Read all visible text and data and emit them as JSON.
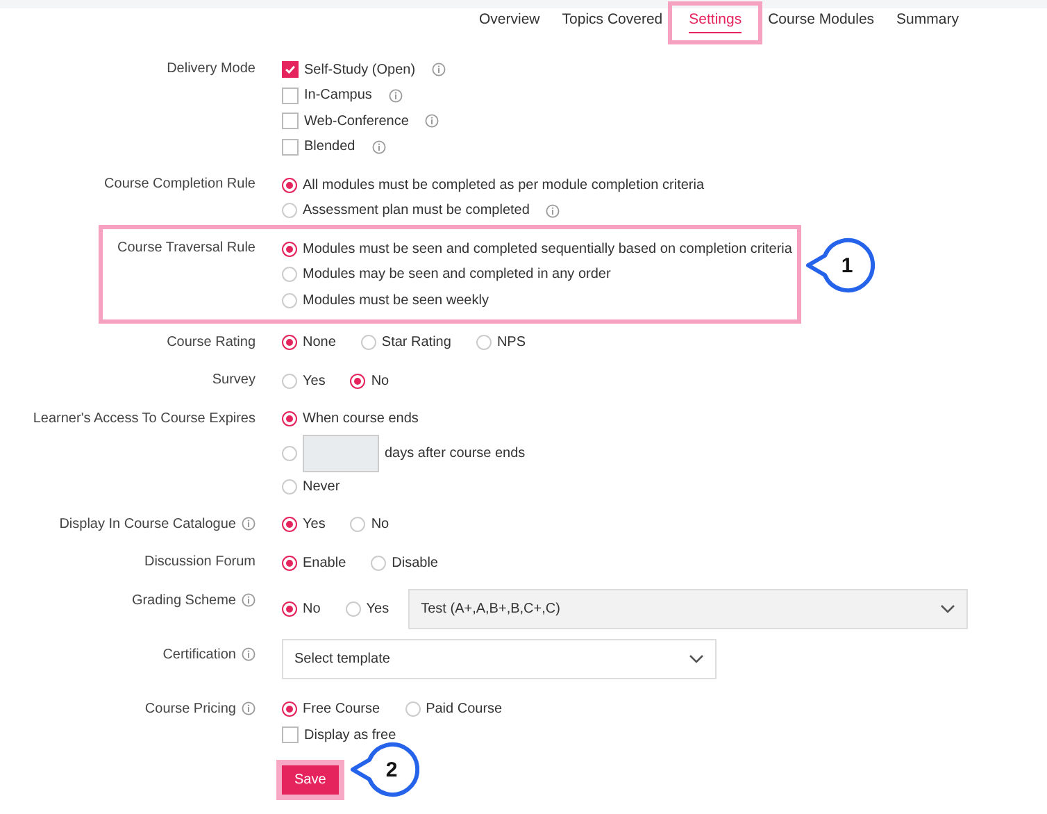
{
  "tabs": [
    {
      "label": "Overview",
      "selected": false,
      "highlighted": false
    },
    {
      "label": "Topics Covered",
      "selected": false,
      "highlighted": false
    },
    {
      "label": "Settings",
      "selected": true,
      "highlighted": true
    },
    {
      "label": "Course Modules",
      "selected": false,
      "highlighted": false
    },
    {
      "label": "Summary",
      "selected": false,
      "highlighted": false
    }
  ],
  "fields": [
    {
      "label": "Delivery Mode",
      "info": false,
      "highlighted": false,
      "lines": [
        [
          {
            "kind": "checkbox",
            "label": "Self-Study (Open)",
            "checked": true,
            "info": true
          }
        ],
        [
          {
            "kind": "checkbox",
            "label": "In-Campus",
            "checked": false,
            "info": true
          }
        ],
        [
          {
            "kind": "checkbox",
            "label": "Web-Conference",
            "checked": false,
            "info": true
          }
        ],
        [
          {
            "kind": "checkbox",
            "label": "Blended",
            "checked": false,
            "info": true
          }
        ]
      ]
    },
    {
      "label": "Course Completion Rule",
      "info": false,
      "highlighted": false,
      "lines": [
        [
          {
            "kind": "radio",
            "label": "All modules must be completed as per module completion criteria",
            "selected": true,
            "info": false
          }
        ],
        [
          {
            "kind": "radio",
            "label": "Assessment plan must be completed",
            "selected": false,
            "info": true
          }
        ]
      ]
    },
    {
      "label": "Course Traversal Rule",
      "info": false,
      "highlighted": true,
      "callout": "1",
      "lines": [
        [
          {
            "kind": "radio",
            "label": "Modules must be seen and completed sequentially based on completion criteria",
            "selected": true,
            "info": false
          }
        ],
        [
          {
            "kind": "radio",
            "label": "Modules may be seen and completed in any order",
            "selected": false,
            "info": false
          }
        ],
        [
          {
            "kind": "radio",
            "label": "Modules must be seen weekly",
            "selected": false,
            "info": false
          }
        ]
      ]
    },
    {
      "label": "Course Rating",
      "info": false,
      "highlighted": false,
      "lines": [
        [
          {
            "kind": "radio",
            "label": "None",
            "selected": true,
            "info": false
          },
          {
            "kind": "radio",
            "label": "Star Rating",
            "selected": false,
            "info": false
          },
          {
            "kind": "radio",
            "label": "NPS",
            "selected": false,
            "info": false
          }
        ]
      ]
    },
    {
      "label": "Survey",
      "info": false,
      "highlighted": false,
      "lines": [
        [
          {
            "kind": "radio",
            "label": "Yes",
            "selected": false,
            "info": false
          },
          {
            "kind": "radio",
            "label": "No",
            "selected": true,
            "info": false
          }
        ]
      ]
    },
    {
      "label": "Learner's Access To Course Expires",
      "info": false,
      "highlighted": false,
      "lines": [
        [
          {
            "kind": "radio",
            "label": "When course ends",
            "selected": true,
            "info": false
          }
        ],
        [
          {
            "kind": "radio",
            "selected": false,
            "info": false
          },
          {
            "kind": "input"
          },
          {
            "kind": "text",
            "label": "days after course ends"
          }
        ],
        [
          {
            "kind": "radio",
            "label": "Never",
            "selected": false,
            "info": false
          }
        ]
      ]
    },
    {
      "label": "Display In Course Catalogue",
      "info": true,
      "highlighted": false,
      "lines": [
        [
          {
            "kind": "radio",
            "label": "Yes",
            "selected": true,
            "info": false
          },
          {
            "kind": "radio",
            "label": "No",
            "selected": false,
            "info": false
          }
        ]
      ]
    },
    {
      "label": "Discussion Forum",
      "info": false,
      "highlighted": false,
      "lines": [
        [
          {
            "kind": "radio",
            "label": "Enable",
            "selected": true,
            "info": false
          },
          {
            "kind": "radio",
            "label": "Disable",
            "selected": false,
            "info": false
          }
        ]
      ]
    },
    {
      "label": "Grading Scheme",
      "info": true,
      "highlighted": false,
      "lines": [
        [
          {
            "kind": "radio",
            "label": "No",
            "selected": true,
            "info": false
          },
          {
            "kind": "radio",
            "label": "Yes",
            "selected": false,
            "info": false
          },
          {
            "kind": "select",
            "value": "Test (A+,A,B+,B,C+,C)"
          }
        ]
      ]
    },
    {
      "label": "Certification",
      "info": true,
      "highlighted": false,
      "lines": [
        [
          {
            "kind": "select",
            "value": "Select template"
          }
        ]
      ]
    },
    {
      "label": "Course Pricing",
      "info": true,
      "highlighted": false,
      "lines": [
        [
          {
            "kind": "radio",
            "label": "Free Course",
            "selected": true,
            "info": false
          },
          {
            "kind": "radio",
            "label": "Paid Course",
            "selected": false,
            "info": false
          }
        ],
        [
          {
            "kind": "checkbox",
            "label": "Display as free",
            "checked": false,
            "info": false
          }
        ]
      ]
    }
  ],
  "save": {
    "label": "Save",
    "highlighted": true,
    "callout": "2"
  }
}
